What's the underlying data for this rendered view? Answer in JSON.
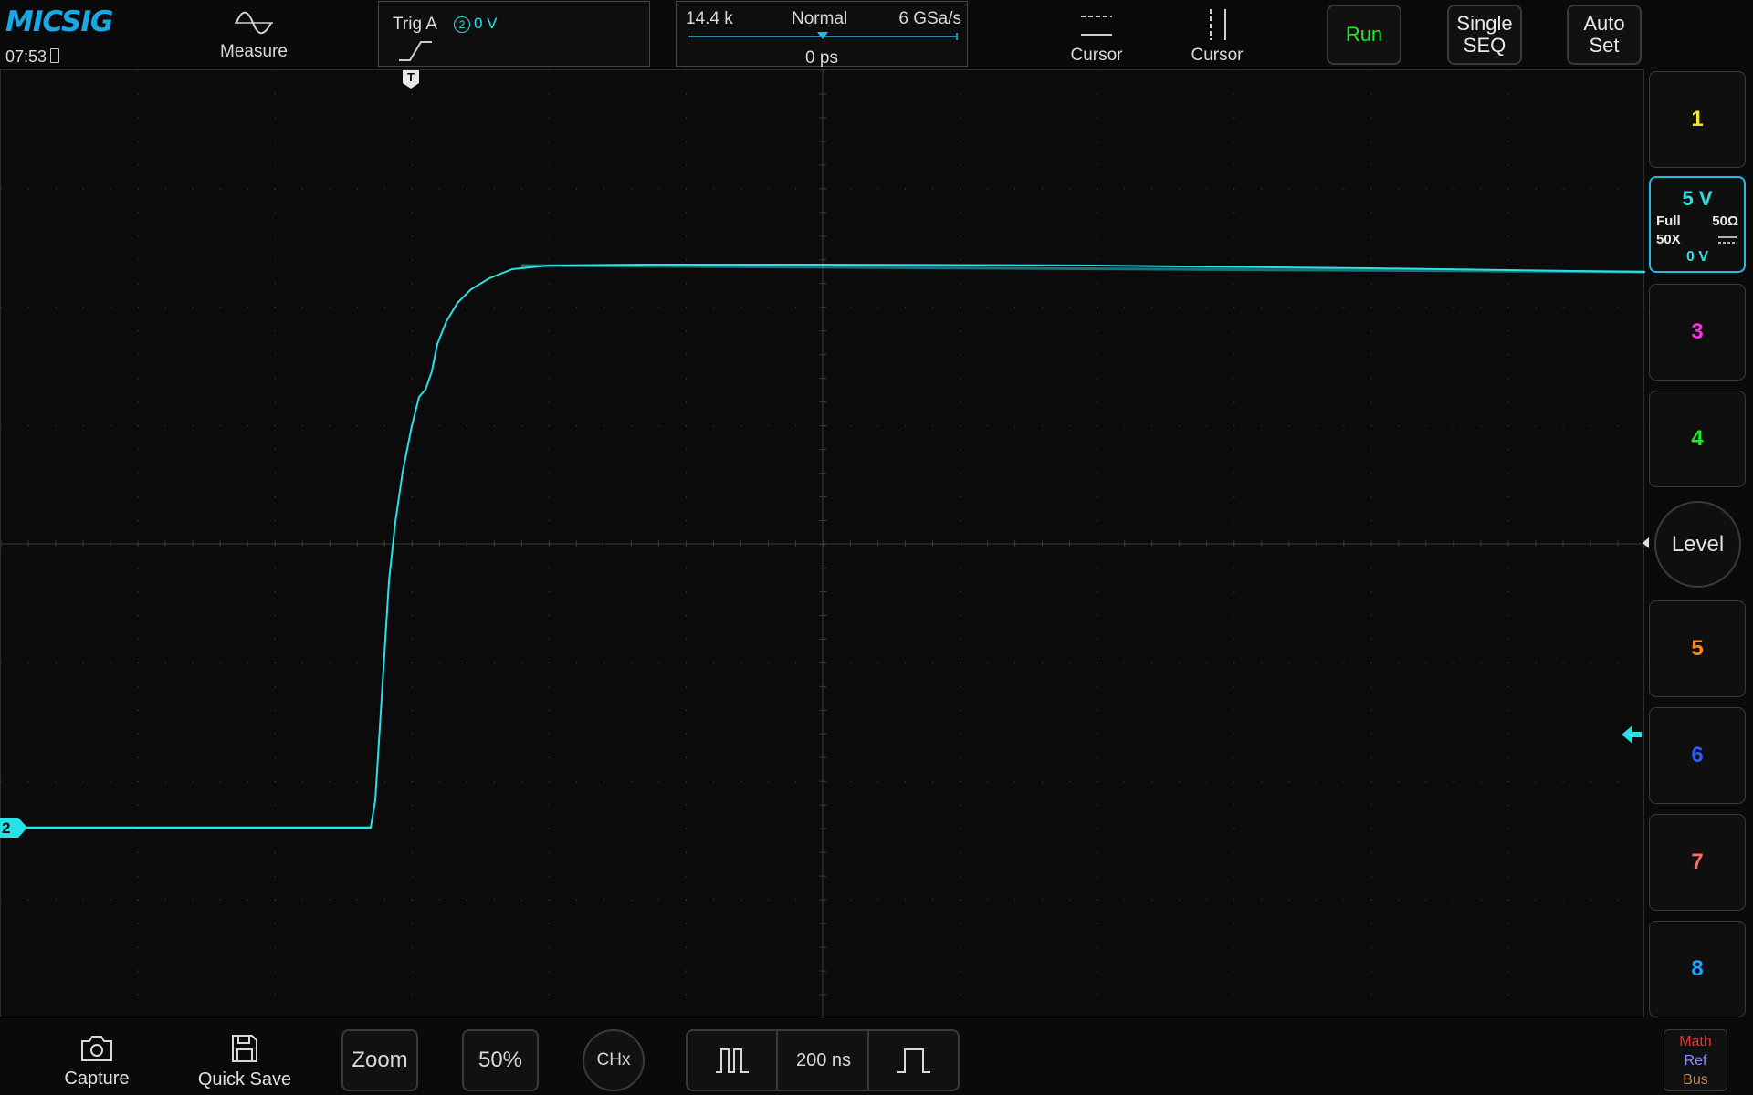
{
  "colors": {
    "ch1": "#f2e52a",
    "ch2": "#27e2e6",
    "ch3": "#ff2de0",
    "ch4": "#22e82c",
    "ch5": "#ff8a1f",
    "ch6": "#2a5cff",
    "ch7": "#ff6a6a",
    "ch8": "#1aa7ff",
    "run": "#22e82c",
    "math": "#ff2a2a",
    "ref": "#8c8cff",
    "bus": "#c08a4a"
  },
  "header": {
    "logo": "MICSIG",
    "clock": "07:53",
    "measure_label": "Measure",
    "cursor_h_label": "Cursor",
    "cursor_v_label": "Cursor"
  },
  "trigger": {
    "label": "Trig A",
    "source_channel": "2",
    "level": "0 V",
    "edge_icon": "rising-edge-icon"
  },
  "timebase": {
    "memory_depth": "14.4 k",
    "acq_mode": "Normal",
    "sample_rate": "6 GSa/s",
    "position": "0 ps"
  },
  "buttons": {
    "run": "Run",
    "single_line1": "Single",
    "single_line2": "SEQ",
    "auto_line1": "Auto",
    "auto_line2": "Set"
  },
  "channels": {
    "ch1": "1",
    "ch2": {
      "scale": "5 V",
      "bandwidth": "Full",
      "impedance": "50Ω",
      "probe": "50X",
      "coupling_icon": "dc-coupling-icon",
      "offset": "0 V"
    },
    "ch3": "3",
    "ch4": "4",
    "level_label": "Level",
    "ch5": "5",
    "ch6": "6",
    "ch7": "7",
    "ch8": "8",
    "trace_marker": "2",
    "trigger_marker": "T"
  },
  "bottom": {
    "capture": "Capture",
    "quick_save": "Quick Save",
    "zoom": "Zoom",
    "fifty_pct": "50%",
    "chx": "CHx",
    "time_scale": "200 ns",
    "math": "Math",
    "ref": "Ref",
    "bus": "Bus"
  }
}
